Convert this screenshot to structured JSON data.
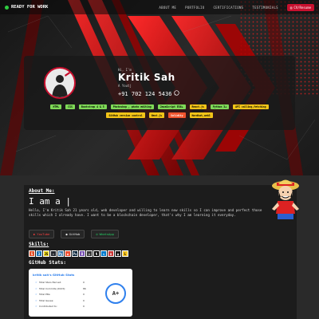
{
  "nav": {
    "brand": "READY FOR WORK",
    "items": [
      "ABOUT ME",
      "PORTFOLIO",
      "CERTIFICATIONS",
      "TESTIMONIALS"
    ],
    "resume_label": "CV/Resume"
  },
  "profile": {
    "greeting": "Hi, I'm",
    "name": "Kritik Sah",
    "subtitle": "A Youtj",
    "phone": "+91 702 124 5436"
  },
  "tags": [
    {
      "label": "HTML",
      "color": "#7ed957",
      "text": "#000"
    },
    {
      "label": "CSS",
      "color": "#7ed957",
      "text": "#000"
    },
    {
      "label": "Bootstrap 4 & 5",
      "color": "#7ed957",
      "text": "#000"
    },
    {
      "label": "Photoshop , photo editing",
      "color": "#7ed957",
      "text": "#000"
    },
    {
      "label": "JavaScript ES6+",
      "color": "#7ed957",
      "text": "#000"
    },
    {
      "label": "React.js",
      "color": "#f2c418",
      "text": "#000"
    },
    {
      "label": "Python 3+",
      "color": "#7ed957",
      "text": "#000"
    },
    {
      "label": "API calling,fetching",
      "color": "#f2c418",
      "text": "#000"
    },
    {
      "label": "GitHub version control",
      "color": "#f2c418",
      "text": "#000"
    },
    {
      "label": "Next.js",
      "color": "#f2c418",
      "text": "#000"
    },
    {
      "label": "Solidity",
      "color": "#f2542d",
      "text": "#fff"
    },
    {
      "label": "Hardhat,web3",
      "color": "#f2c418",
      "text": "#000"
    }
  ],
  "about": {
    "title": "About Me:",
    "typed": "I am a |",
    "paragraph": "Hello, I'm Kritik Sah 21 years old, web developer and willing to learn new skills so I can improve and perfect those skills which I already have. I want to be a blockchain developer, that's why I am learning it everyday.",
    "buttons": [
      {
        "label": "YouTube",
        "icon": "youtube-icon",
        "color": "#ff4040"
      },
      {
        "label": "GitHub",
        "icon": "github-icon",
        "color": "#ffffff"
      },
      {
        "label": "WhatsApp",
        "icon": "whatsapp-icon",
        "color": "#25d366"
      }
    ]
  },
  "skills": {
    "title": "Skills:",
    "icons": [
      {
        "name": "html-icon",
        "glyph": "5",
        "bg": "#e34f26"
      },
      {
        "name": "css-icon",
        "glyph": "3",
        "bg": "#1572b6"
      },
      {
        "name": "javascript-icon",
        "glyph": "JS",
        "bg": "#f7df1e"
      },
      {
        "name": "react-icon",
        "glyph": "⚛",
        "bg": "#20232a"
      },
      {
        "name": "python-icon",
        "glyph": "Py",
        "bg": "#3776ab"
      },
      {
        "name": "git-icon",
        "glyph": "◆",
        "bg": "#f05032"
      },
      {
        "name": "photoshop-icon",
        "glyph": "Ps",
        "bg": "#001e36"
      },
      {
        "name": "bootstrap-icon",
        "glyph": "B",
        "bg": "#7952b3"
      },
      {
        "name": "solidity-icon",
        "glyph": "◇",
        "bg": "#363636"
      },
      {
        "name": "nextjs-icon",
        "glyph": "N",
        "bg": "#000000"
      },
      {
        "name": "vscode-icon",
        "glyph": "≺",
        "bg": "#007acc"
      },
      {
        "name": "npm-icon",
        "glyph": "n",
        "bg": "#cb3837"
      },
      {
        "name": "github-skill-icon",
        "glyph": "◉",
        "bg": "#181717"
      },
      {
        "name": "linux-icon",
        "glyph": "L",
        "bg": "#fcc624"
      }
    ]
  },
  "github": {
    "title": "GitHub Stats:",
    "card_title": "kritik sah's GitHub Stats",
    "rows": [
      {
        "label": "Total Stars Earned:",
        "value": "0"
      },
      {
        "label": "Total Commits (2023):",
        "value": "86"
      },
      {
        "label": "Total PRs:",
        "value": "0"
      },
      {
        "label": "Total Issues:",
        "value": "0"
      },
      {
        "label": "Contributed to:",
        "value": "0"
      }
    ],
    "rank": "A+"
  },
  "colors": {
    "accent": "#c8102e",
    "background": "#1b1b1b"
  }
}
